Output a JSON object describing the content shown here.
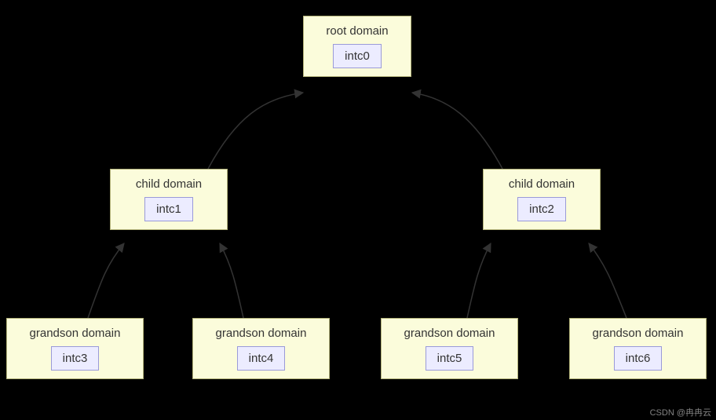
{
  "diagram": {
    "root": {
      "title": "root domain",
      "inner": "intc0"
    },
    "child_left": {
      "title": "child domain",
      "inner": "intc1"
    },
    "child_right": {
      "title": "child domain",
      "inner": "intc2"
    },
    "gs1": {
      "title": "grandson domain",
      "inner": "intc3"
    },
    "gs2": {
      "title": "grandson domain",
      "inner": "intc4"
    },
    "gs3": {
      "title": "grandson domain",
      "inner": "intc5"
    },
    "gs4": {
      "title": "grandson domain",
      "inner": "intc6"
    }
  },
  "watermark": "CSDN @冉冉云"
}
